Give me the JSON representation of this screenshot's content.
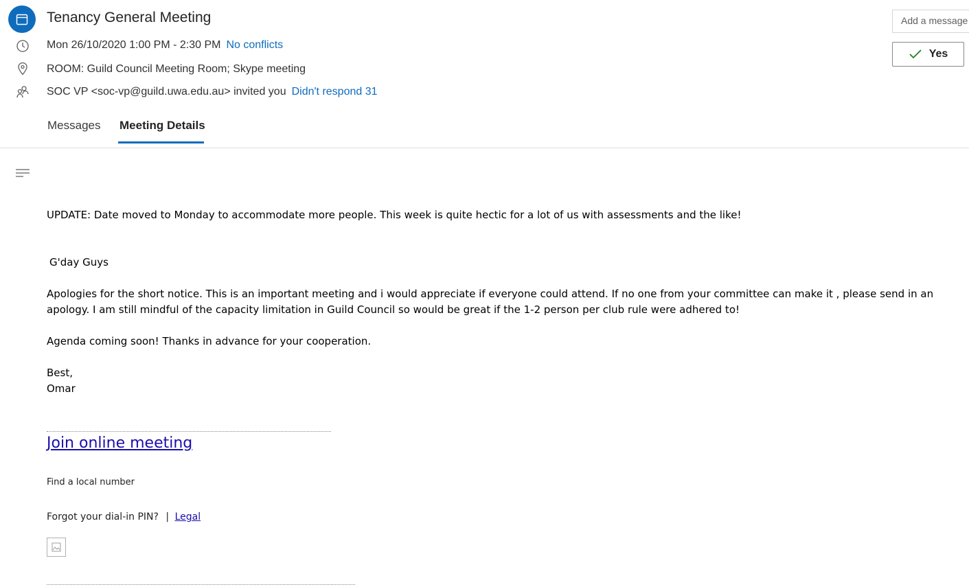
{
  "event": {
    "title": "Tenancy General Meeting",
    "datetime": "Mon 26/10/2020 1:00 PM - 2:30 PM",
    "conflicts": "No conflicts",
    "location": "ROOM: Guild Council Meeting Room; Skype meeting",
    "organizer_text": "SOC VP <soc-vp@guild.uwa.edu.au> invited you",
    "response_status": "Didn't respond 31"
  },
  "actions": {
    "add_message_placeholder": "Add a message",
    "yes_label": "Yes"
  },
  "tabs": [
    {
      "label": "Messages",
      "active": false
    },
    {
      "label": "Meeting Details",
      "active": true
    }
  ],
  "body": {
    "update": "UPDATE: Date moved to Monday to accommodate more people. This week is quite hectic for a lot of us with assessments and the like!",
    "greeting": "G'day Guys",
    "apology": "Apologies for the short notice. This is an important meeting and i would appreciate if everyone could attend. If no one from your committee can make it , please send in an apology. I am still mindful of the capacity limitation in Guild Council so would be great if the 1-2 person per club rule were adhered to!",
    "agenda": "Agenda coming soon! Thanks in advance for your cooperation.",
    "signoff": "Best,",
    "signature": "Omar"
  },
  "meeting_links": {
    "join_label": "Join online meeting",
    "find_local_number": "Find a local number",
    "forgot_pin": "Forgot your dial-in PIN?",
    "separator": "|",
    "legal_label": "Legal"
  },
  "icons": {
    "calendar": "calendar-icon",
    "clock": "clock-icon",
    "location": "location-pin-icon",
    "people": "people-icon",
    "checkmark": "checkmark-icon",
    "body_format": "text-lines-icon",
    "image": "broken-image-icon"
  },
  "colors": {
    "accent": "#0f6cbd",
    "link": "#1a0dab"
  }
}
